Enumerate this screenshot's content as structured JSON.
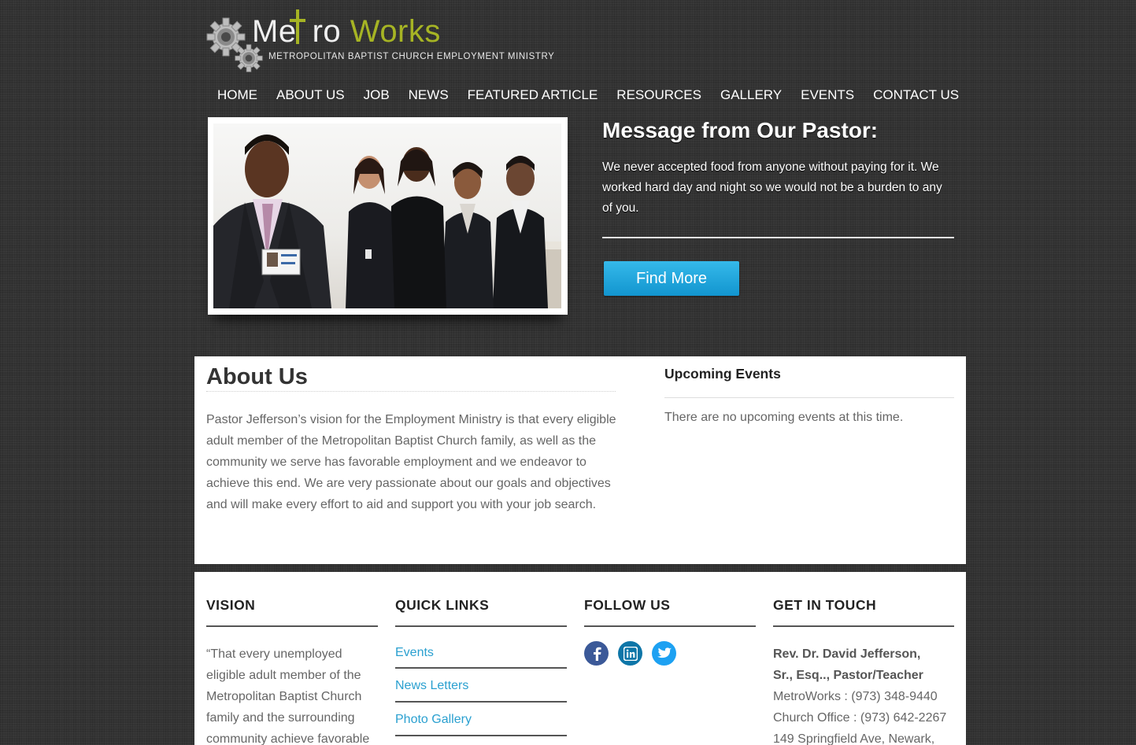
{
  "brand": {
    "title_part1": "Me",
    "title_part2": "ro",
    "title_part3": "Works",
    "subtitle": "METROPOLITAN BAPTIST CHURCH EMPLOYMENT MINISTRY",
    "accent_color": "#a6b424"
  },
  "nav": {
    "items": [
      {
        "label": "HOME"
      },
      {
        "label": "ABOUT US"
      },
      {
        "label": "JOB"
      },
      {
        "label": "NEWS"
      },
      {
        "label": "FEATURED ARTICLE"
      },
      {
        "label": "RESOURCES"
      },
      {
        "label": "GALLERY"
      },
      {
        "label": "EVENTS"
      },
      {
        "label": "CONTACT US"
      }
    ]
  },
  "hero": {
    "title": "Message from Our Pastor:",
    "quote": "We never accepted food from anyone without paying for it. We worked hard day and night so we would not be a burden to any of you.",
    "button_label": "Find More",
    "button_color": "#1a9fd8"
  },
  "about": {
    "title": "About Us",
    "body": "Pastor Jefferson’s vision for the Employment Ministry is that every eligible adult member of the Metropolitan Baptist Church family, as well as the community we serve has favorable employment and we endeavor to achieve this end. We are very passionate about our goals and objectives and will make every effort to aid and support you with your job search."
  },
  "events": {
    "title": "Upcoming Events",
    "empty_text": "There are no upcoming events at this time."
  },
  "footer": {
    "vision": {
      "heading": "VISION",
      "text": "“That every unemployed eligible adult member of the Metropolitan Baptist Church family and the surrounding community achieve favorable"
    },
    "quick_links": {
      "heading": "QUICK LINKS",
      "items": [
        {
          "label": "Events"
        },
        {
          "label": "News Letters"
        },
        {
          "label": "Photo Gallery"
        }
      ],
      "link_color": "#2aa0d0"
    },
    "follow": {
      "heading": "FOLLOW US",
      "icons": [
        "facebook-icon",
        "linkedin-icon",
        "twitter-icon"
      ],
      "colors": {
        "facebook": "#3b5998",
        "linkedin": "#0e76a8",
        "twitter": "#1da1f2"
      }
    },
    "contact": {
      "heading": "GET IN TOUCH",
      "name_line1": "Rev. Dr. David Jefferson,",
      "name_line2": "Sr., Esq.., Pastor/Teacher",
      "metroworks_phone": "MetroWorks : (973) 348-9440",
      "church_phone": "Church Office : (973) 642-2267",
      "address": "149 Springfield Ave, Newark,"
    }
  }
}
